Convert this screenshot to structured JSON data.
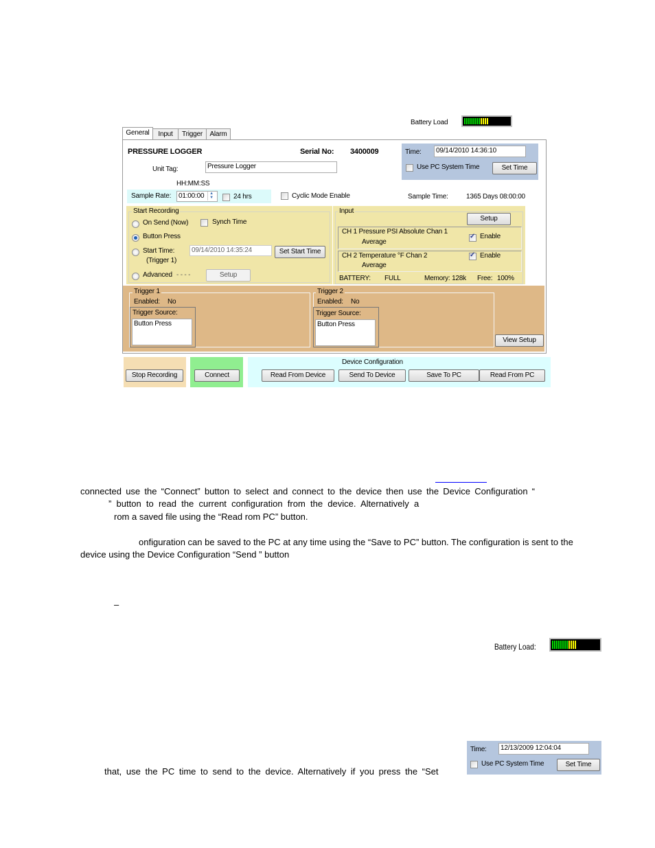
{
  "app": {
    "battery_load_label": "Battery Load",
    "battery_load_fraction": 0.55,
    "tabs": [
      {
        "label": "General",
        "active": true
      },
      {
        "label": "Input",
        "active": false
      },
      {
        "label": "Trigger",
        "active": false
      },
      {
        "label": "Alarm",
        "active": false
      }
    ],
    "general": {
      "title": "PRESSURE LOGGER",
      "serial_label": "Serial No:",
      "serial_value": "3400009",
      "unit_tag_label": "Unit Tag:",
      "unit_tag_value": "Pressure Logger",
      "time_format_hint": "HH:MM:SS",
      "sample_rate_label": "Sample Rate:",
      "sample_rate_value": "01:00:00",
      "hrs24_label": "24 hrs",
      "cyclic_label": "Cyclic Mode Enable",
      "sample_time_label": "Sample Time:",
      "sample_time_value": "1365 Days 08:00:00",
      "time_label": "Time:",
      "time_value": "09/14/2010 14:36:10",
      "use_pc_time_label": "Use PC System Time",
      "set_time_label": "Set Time"
    },
    "start_recording": {
      "title": "Start Recording",
      "on_send_label": "On Send (Now)",
      "synch_label": "Synch Time",
      "button_press_label": "Button Press",
      "start_time_label": "Start Time:",
      "trigger1_label": "(Trigger 1)",
      "start_time_value": "09/14/2010 14:35:24",
      "set_start_time_label": "Set Start Time",
      "advanced_label": "Advanced",
      "advanced_dashes": "- - - -",
      "setup_label": "Setup",
      "selected": "Button Press"
    },
    "input": {
      "title": "Input",
      "setup_label": "Setup",
      "channels": [
        {
          "name": "CH 1 Pressure PSI Absolute Chan 1",
          "mode": "Average",
          "enable_label": "Enable",
          "enabled": true
        },
        {
          "name": "CH 2 Temperature °F Chan 2",
          "mode": "Average",
          "enable_label": "Enable",
          "enabled": true
        }
      ],
      "battery_label": "BATTERY:",
      "battery_value": "FULL",
      "memory_label": "Memory: 128k",
      "free_label": "Free:",
      "free_value": "100%"
    },
    "triggers": [
      {
        "title": "Trigger 1",
        "enabled_label": "Enabled:",
        "enabled_value": "No",
        "source_label": "Trigger Source:",
        "source_value": "Button Press"
      },
      {
        "title": "Trigger 2",
        "enabled_label": "Enabled:",
        "enabled_value": "No",
        "source_label": "Trigger Source:",
        "source_value": "Button Press"
      }
    ],
    "view_setup_label": "View Setup",
    "bottom": {
      "stop_recording_label": "Stop Recording",
      "connect_label": "Connect",
      "device_config_label": "Device Configuration",
      "read_from_device_label": "Read From Device",
      "send_to_device_label": "Send To Device",
      "save_to_pc_label": "Save To PC",
      "read_from_pc_label": "Read From PC"
    }
  },
  "doc": {
    "lines": [
      "connected use the “Connect” button to select and connect to the device then use the Device Configuration “",
      "” button to read the current configuration from the device. Alternatively a",
      "rom a saved file using the “Read   rom PC” button.",
      "onfiguration can be saved to the PC at any time using the “Save to PC” button. The configuration is sent to the",
      "device using the Device Configuration “Send              ” button",
      "–",
      "that, use the PC time to send to the device. Alternatively if you press the “Set"
    ],
    "inset_battery": {
      "label": "Battery Load:",
      "fraction": 0.55
    },
    "inset_time": {
      "time_label": "Time:",
      "time_value": "12/13/2009 12:04:04",
      "use_pc_label": "Use PC System Time",
      "set_time_label": "Set Time"
    }
  }
}
